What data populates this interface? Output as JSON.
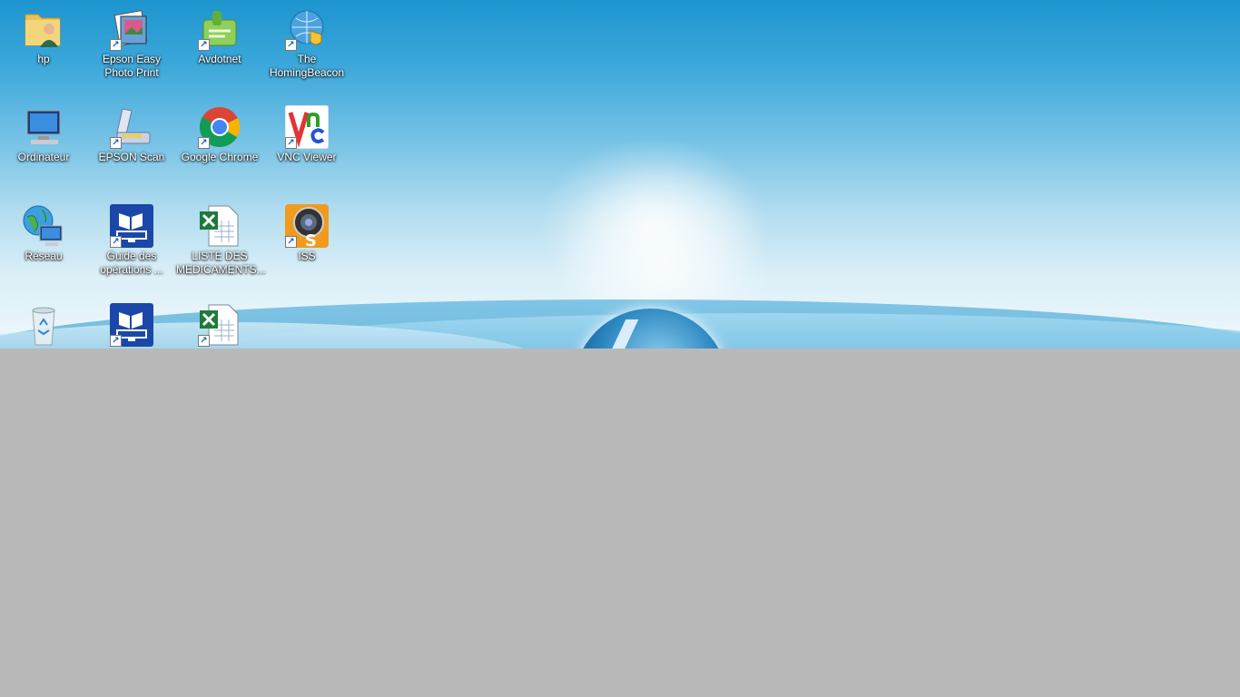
{
  "desktop": {
    "icons": [
      {
        "label": "hp",
        "icon": "user-folder-icon",
        "shortcut": false
      },
      {
        "label": "Epson Easy Photo Print",
        "icon": "epson-easy-photo-print-icon",
        "shortcut": true
      },
      {
        "label": "Avdotnet",
        "icon": "avdotnet-icon",
        "shortcut": true
      },
      {
        "label": "The HomingBeacon",
        "icon": "homingbeacon-icon",
        "shortcut": true
      },
      {
        "label": "Ordinateur",
        "icon": "computer-icon",
        "shortcut": false
      },
      {
        "label": "EPSON Scan",
        "icon": "scanner-icon",
        "shortcut": true
      },
      {
        "label": "Google Chrome",
        "icon": "chrome-icon",
        "shortcut": true
      },
      {
        "label": "VNC Viewer",
        "icon": "vnc-viewer-icon",
        "shortcut": true
      },
      {
        "label": "Réseau",
        "icon": "network-icon",
        "shortcut": false
      },
      {
        "label": "Guide des opérations ...",
        "icon": "epson-guide-icon",
        "shortcut": true
      },
      {
        "label": "LISTE DES MEDICAMENTS...",
        "icon": "excel-file-icon",
        "shortcut": false
      },
      {
        "label": "ISS",
        "icon": "iss-camera-icon",
        "shortcut": true
      },
      {
        "label": "",
        "icon": "recycle-bin-icon",
        "shortcut": false
      },
      {
        "label": "",
        "icon": "epson-guide-icon",
        "shortcut": true
      },
      {
        "label": "",
        "icon": "excel-file-icon",
        "shortcut": true
      }
    ],
    "shortcut_glyph": "↗"
  },
  "colors": {
    "sky_top": "#1d95cf",
    "lower_area": "#b9b9b9",
    "label_text": "#ffffff"
  }
}
